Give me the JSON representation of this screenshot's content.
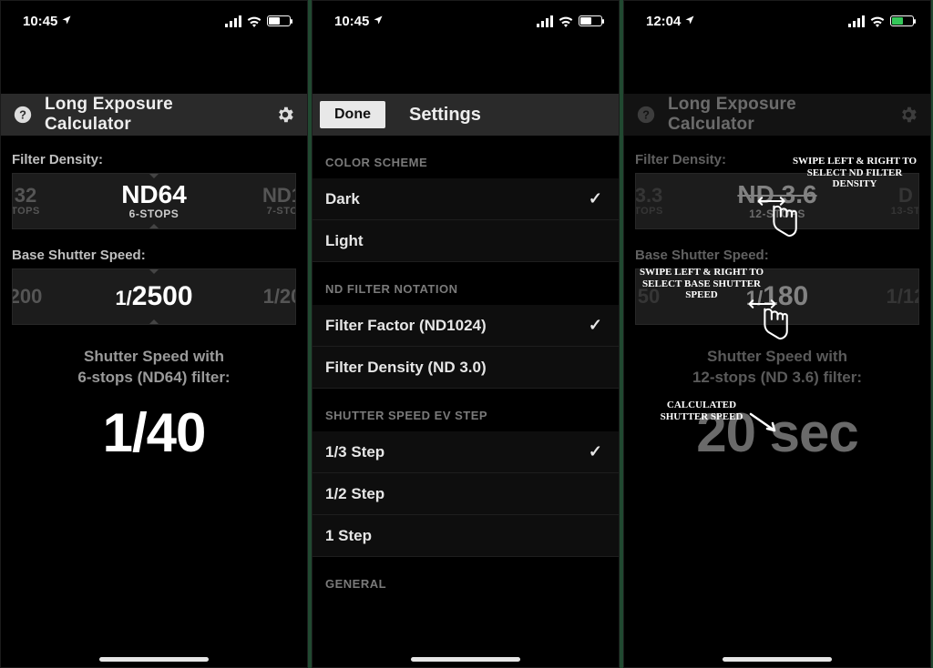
{
  "screen1": {
    "status_time": "10:45",
    "app_title": "Long Exposure Calculator",
    "filter_density_label": "Filter Density:",
    "filter_left_main": "32",
    "filter_left_sub": "TOPS",
    "filter_center_main": "ND64",
    "filter_center_sub": "6-STOPS",
    "filter_right_main": "ND1",
    "filter_right_sub": "7-STO",
    "shutter_label": "Base Shutter Speed:",
    "shutter_left": "200",
    "shutter_center_prefix": "1/",
    "shutter_center_main": "2500",
    "shutter_right": "1/20",
    "result_line1": "Shutter Speed with",
    "result_line2": "6-stops (ND64) filter:",
    "result_value": "1/40"
  },
  "screen2": {
    "status_time": "10:45",
    "done_label": "Done",
    "nav_title": "Settings",
    "sections": {
      "color_scheme": {
        "header": "COLOR SCHEME",
        "options": [
          {
            "label": "Dark",
            "checked": true
          },
          {
            "label": "Light",
            "checked": false
          }
        ]
      },
      "nd_notation": {
        "header": "ND FILTER NOTATION",
        "options": [
          {
            "label": "Filter Factor (ND1024)",
            "checked": true
          },
          {
            "label": "Filter Density (ND 3.0)",
            "checked": false
          }
        ]
      },
      "ev_step": {
        "header": "SHUTTER SPEED EV STEP",
        "options": [
          {
            "label": "1/3 Step",
            "checked": true
          },
          {
            "label": "1/2 Step",
            "checked": false
          },
          {
            "label": "1 Step",
            "checked": false
          }
        ]
      },
      "general": {
        "header": "GENERAL"
      }
    }
  },
  "screen3": {
    "status_time": "12:04",
    "app_title": "Long Exposure Calculator",
    "filter_density_label": "Filter Density:",
    "filter_left_main": "3.3",
    "filter_left_sub": "TOPS",
    "filter_center_main": "ND 3.6",
    "filter_center_sub": "12-STOPS",
    "filter_right_main": "D",
    "filter_right_sub": "13-ST",
    "shutter_label": "Base Shutter Speed:",
    "shutter_left": "50",
    "shutter_center_prefix": "1/",
    "shutter_center_main": "180",
    "shutter_right": "1/12",
    "result_line1": "Shutter Speed with",
    "result_line2": "12-stops (ND 3.6) filter:",
    "result_value": "20 sec",
    "anno_filter": "SWIPE LEFT & RIGHT TO SELECT ND FILTER DENSITY",
    "anno_shutter": "SWIPE LEFT & RIGHT TO SELECT BASE SHUTTER SPEED",
    "anno_result": "CALCULATED SHUTTER SPEED"
  }
}
